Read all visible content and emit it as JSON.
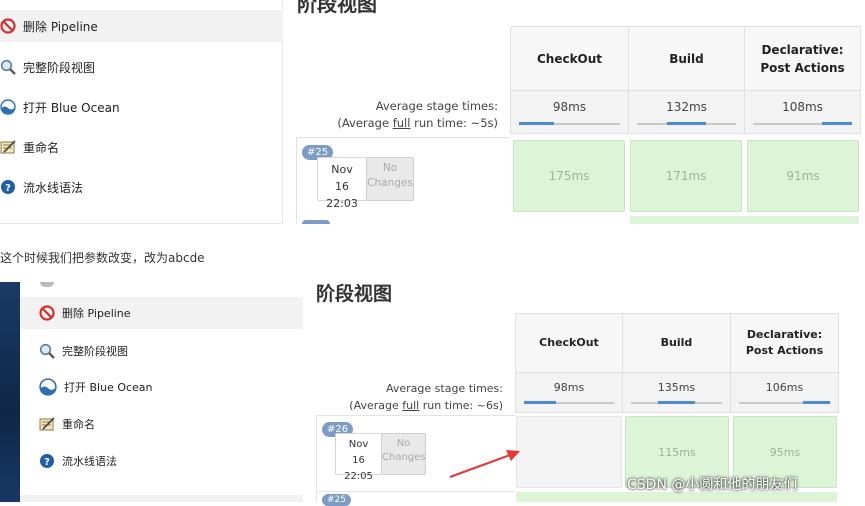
{
  "sidebar": {
    "items": [
      {
        "label": "删除 Pipeline",
        "icon": "no-entry-icon"
      },
      {
        "label": "完整阶段视图",
        "icon": "magnifier-icon"
      },
      {
        "label": "打开 Blue Ocean",
        "icon": "blue-ocean-icon"
      },
      {
        "label": "重命名",
        "icon": "notepad-icon"
      },
      {
        "label": "流水线语法",
        "icon": "help-icon"
      }
    ]
  },
  "stage_view_title": "阶段视图",
  "stages": [
    {
      "name": "CheckOut"
    },
    {
      "name": "Build"
    },
    {
      "name": "Declarative:",
      "name2": "Post Actions"
    }
  ],
  "panel1": {
    "avg_label": "Average stage times:",
    "full_prefix": "(Average ",
    "full_link": "full",
    "full_suffix": " run time: ~5s)",
    "avg_times": [
      "98ms",
      "132ms",
      "108ms"
    ],
    "avg_fill": [
      0.35,
      0.4,
      0.3
    ],
    "run": {
      "badge": "#25",
      "date": "Nov 16",
      "time": "22:03",
      "no_changes": "No Changes",
      "cells": [
        "175ms",
        "171ms",
        "91ms"
      ]
    }
  },
  "caption": "这个时候我们把参数改变，改为abcde",
  "panel2": {
    "avg_label": "Average stage times:",
    "full_prefix": "(Average ",
    "full_link": "full",
    "full_suffix": " run time: ~6s)",
    "avg_times": [
      "98ms",
      "135ms",
      "106ms"
    ],
    "avg_fill": [
      0.35,
      0.4,
      0.3
    ],
    "run": {
      "badge": "#26",
      "date": "Nov 16",
      "time": "22:05",
      "no_changes": "No Changes",
      "cells": [
        "",
        "115ms",
        "95ms"
      ]
    },
    "next_badge": "#25"
  },
  "watermark": "CSDN @小圆和他的朋友们",
  "colors": {
    "accent": "#4c8ad6",
    "success": "#dcf5d7",
    "badge": "#7b9cc6",
    "arrow": "#e53935"
  }
}
